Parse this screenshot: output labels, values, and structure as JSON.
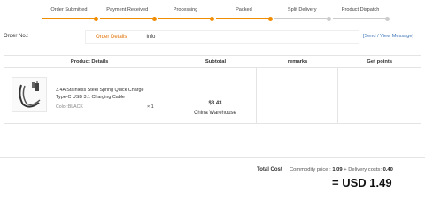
{
  "progress": {
    "steps": [
      {
        "label": "Order Submitted",
        "done": true
      },
      {
        "label": "Payment Received",
        "done": true
      },
      {
        "label": "Processing",
        "done": true
      },
      {
        "label": "Packed",
        "done": true
      },
      {
        "label": "Split Delivery",
        "done": false
      },
      {
        "label": "Product Dispatch",
        "done": false
      }
    ],
    "accent_color": "#f08c00",
    "inactive_color": "#cccccc"
  },
  "order": {
    "number_label": "Order No.:",
    "tabs": [
      "Order Details",
      "Info"
    ],
    "send_link": "[Send / View Message]"
  },
  "table": {
    "headers": [
      "Product Details",
      "Subtotal",
      "remarks",
      "Get points"
    ],
    "row": {
      "title": "3.4A Stainless Steel Spring Quick Charge Type-C USB 3.1 Charging Cable",
      "color": "Color:BLACK",
      "qty": "× 1",
      "subtotal": "$3.43",
      "warehouse": "China Warehouse",
      "image_icon": "usb-cable-image"
    }
  },
  "totals": {
    "label": "Total Cost",
    "commodity_label": "Commodity price :",
    "commodity_value": "1.09",
    "delivery_label": " + Delivery costs:",
    "delivery_value": "0.40",
    "grand": "= USD 1.49"
  }
}
